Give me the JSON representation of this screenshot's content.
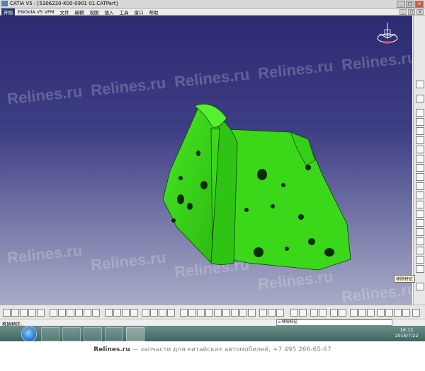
{
  "window": {
    "title": "CATIA V5 - [5306220-K00-0901 01.CATPart]"
  },
  "menu": {
    "items": [
      "开始",
      "ENOVIA V5 VPM",
      "文件",
      "编辑",
      "视图",
      "插入",
      "工具",
      "窗口",
      "帮助"
    ]
  },
  "viewport": {
    "watermark": "Relines.ru",
    "part_color": "#33cc14",
    "background_top": "#2c2b71",
    "background_bottom": "#a8acc6"
  },
  "right_toolbar": {
    "tooltip": "移除特征"
  },
  "status": {
    "text": "移除特征。",
    "command_value": "c:移除特征"
  },
  "tray": {
    "time": "16:12",
    "date": "2016/7/22"
  },
  "footer": {
    "site": "Relines.ru",
    "tagline": " — запчасти для китайских автомобилей, +7 495 266-65-67"
  }
}
